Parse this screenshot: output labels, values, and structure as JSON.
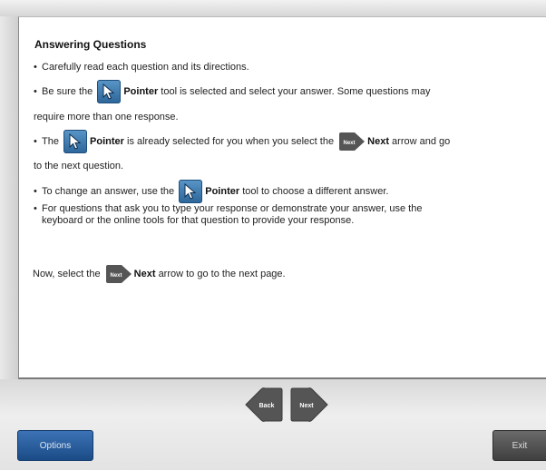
{
  "content": {
    "title": "Answering Questions",
    "bullets": {
      "b1": "Carefully read each question and its directions.",
      "b2_pre": "Be sure the",
      "b2_tool": "Pointer",
      "b2_post": "tool is selected and select your answer. Some questions may",
      "b2_cont": "require more than one response.",
      "b3_pre": "The",
      "b3_tool": "Pointer",
      "b3_mid": "is already selected for you when you select the",
      "b3_next": "Next",
      "b3_post": "arrow and go",
      "b3_cont": "to the next question.",
      "b4_pre": "To change an answer, use the",
      "b4_tool": "Pointer",
      "b4_post": "tool to choose a different answer.",
      "b5_line1": "For questions that ask you to type your response or demonstrate your answer, use the",
      "b5_line2": "keyboard or the online tools for that question to provide your response."
    },
    "closing": {
      "pre": "Now, select the",
      "next": "Next",
      "post": "arrow to go to the next page."
    },
    "bullet_char": "•",
    "icon_next_text": "Next"
  },
  "navigation": {
    "back_label": "Back",
    "next_label": "Next"
  },
  "footer": {
    "options_label": "Options",
    "exit_label": "Exit"
  },
  "colors": {
    "pointer_icon": "#2c6599",
    "nav_arrow": "#555555",
    "options_button": "#1a4b86",
    "exit_button": "#3f3f3f"
  }
}
